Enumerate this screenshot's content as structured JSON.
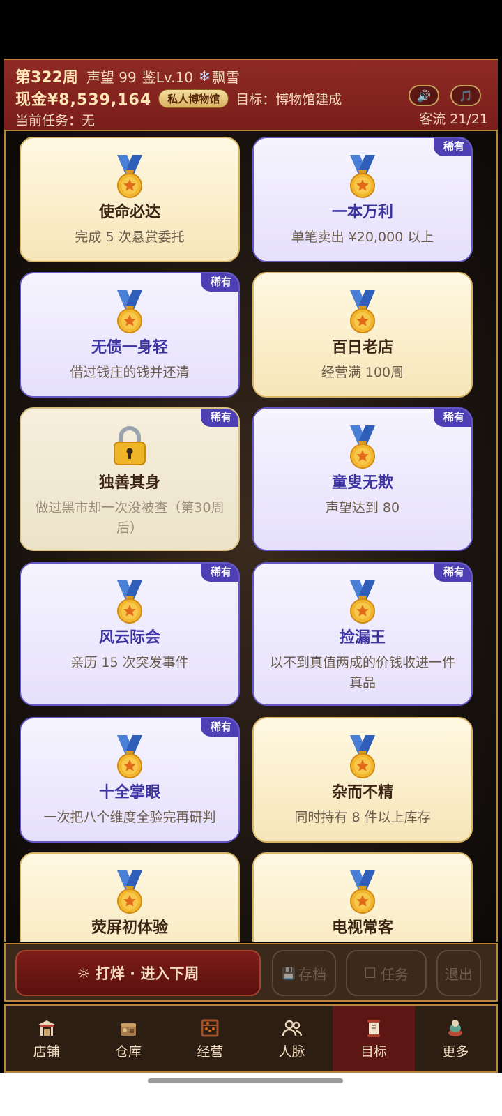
{
  "header": {
    "week": "第322周",
    "reputation": "声望 99",
    "level": "鉴Lv.10",
    "weather_icon": "❄",
    "weather": "飘雪",
    "cash": "现金¥8,539,164",
    "museum_badge": "私人博物馆",
    "goal": "目标：博物馆建成",
    "task": "当前任务：无",
    "traffic": "客流 21/21",
    "sound_icon": "🔊",
    "music_icon": "🎵"
  },
  "cards": [
    {
      "title": "使命必达",
      "desc": "完成 5 次悬赏委托",
      "rare": false,
      "locked": false
    },
    {
      "title": "一本万利",
      "desc": "单笔卖出 ¥20,000 以上",
      "rare": true,
      "locked": false
    },
    {
      "title": "无债一身轻",
      "desc": "借过钱庄的钱并还清",
      "rare": true,
      "locked": false
    },
    {
      "title": "百日老店",
      "desc": "经营满 100周",
      "rare": false,
      "locked": false
    },
    {
      "title": "独善其身",
      "desc": "做过黑市却一次没被查（第30周后）",
      "rare": true,
      "locked": true
    },
    {
      "title": "童叟无欺",
      "desc": "声望达到 80",
      "rare": true,
      "locked": false
    },
    {
      "title": "风云际会",
      "desc": "亲历 15 次突发事件",
      "rare": true,
      "locked": false
    },
    {
      "title": "捡漏王",
      "desc": "以不到真值两成的价钱收进一件真品",
      "rare": true,
      "locked": false
    },
    {
      "title": "十全掌眼",
      "desc": "一次把八个维度全验完再研判",
      "rare": true,
      "locked": false
    },
    {
      "title": "杂而不精",
      "desc": "同时持有 8 件以上库存",
      "rare": false,
      "locked": false
    },
    {
      "title": "荧屏初体验",
      "desc": "",
      "rare": false,
      "locked": false
    },
    {
      "title": "电视常客",
      "desc": "",
      "rare": false,
      "locked": false
    }
  ],
  "rare_label": "稀有",
  "actions": {
    "next_week": "☼ 打烊 · 进入下周",
    "save": "存档",
    "save_icon": "💾",
    "tasks": "任务",
    "tasks_icon": "☐",
    "quit": "退出"
  },
  "tabs": [
    {
      "label": "店铺",
      "icon": "shop-icon",
      "active": false
    },
    {
      "label": "仓库",
      "icon": "warehouse-icon",
      "active": false
    },
    {
      "label": "经营",
      "icon": "abacus-icon",
      "active": false
    },
    {
      "label": "人脉",
      "icon": "people-icon",
      "active": false
    },
    {
      "label": "目标",
      "icon": "scroll-icon",
      "active": true
    },
    {
      "label": "更多",
      "icon": "more-icon",
      "active": false
    }
  ]
}
